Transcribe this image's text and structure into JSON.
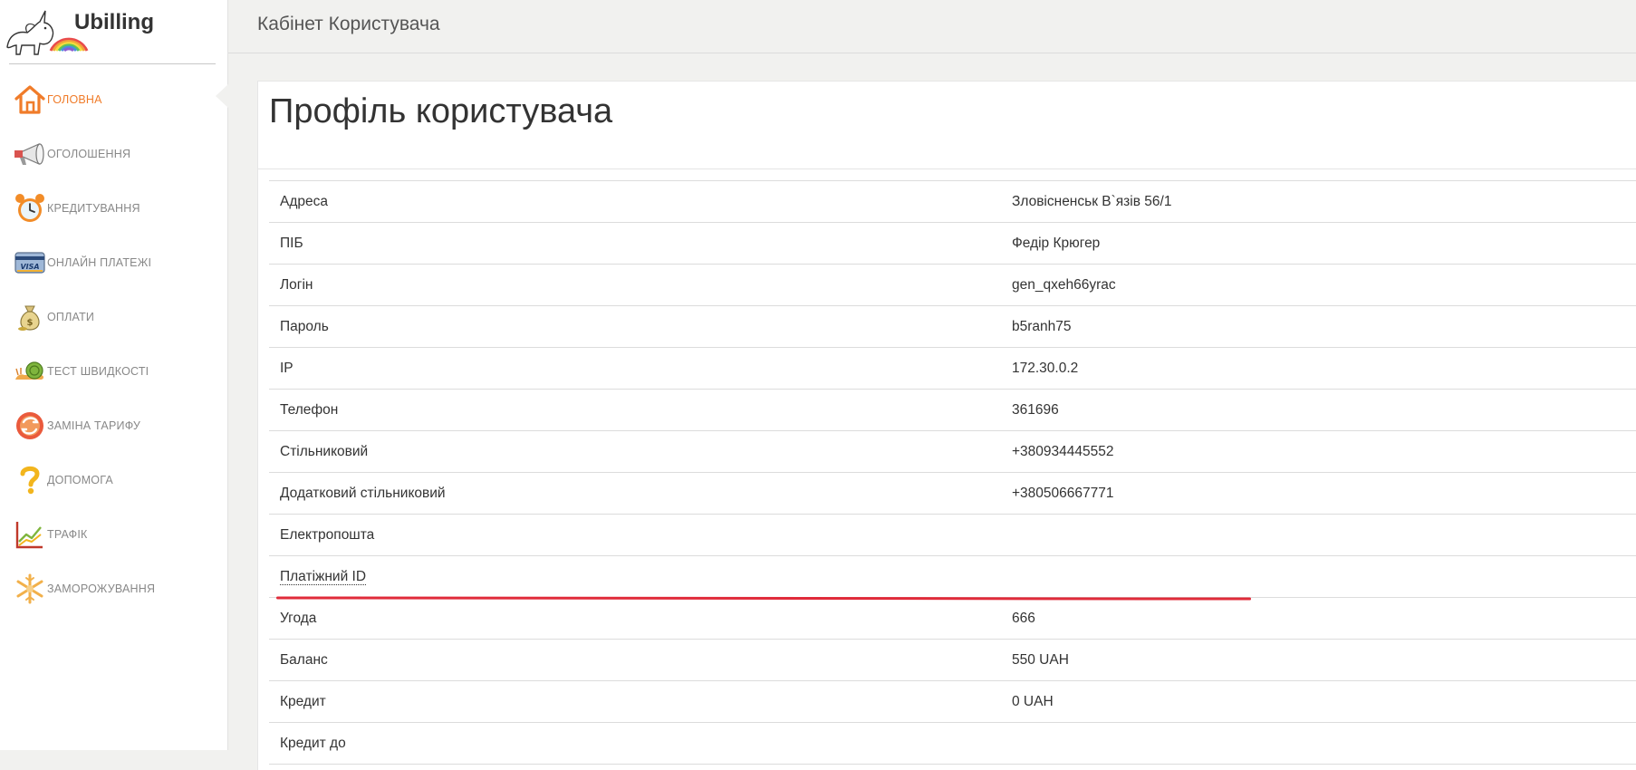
{
  "brand": {
    "name": "Ubilling"
  },
  "menu": [
    {
      "label": "Головна",
      "icon": "home-icon",
      "active": true
    },
    {
      "label": "Оголошення",
      "icon": "megaphone-icon"
    },
    {
      "label": "Кредитування",
      "icon": "alarm-clock-icon"
    },
    {
      "label": "Онлайн платежі",
      "icon": "visa-card-icon"
    },
    {
      "label": "Оплати",
      "icon": "money-bag-icon"
    },
    {
      "label": "Тест швидкості",
      "icon": "snail-icon"
    },
    {
      "label": "Заміна тарифу",
      "icon": "tariff-swap-icon"
    },
    {
      "label": "Допомога",
      "icon": "question-icon"
    },
    {
      "label": "Трафік",
      "icon": "chart-icon"
    },
    {
      "label": "Заморожування",
      "icon": "snowflake-icon"
    }
  ],
  "header": {
    "title": "Кабінет Користувача"
  },
  "profile": {
    "title": "Профіль користувача",
    "rows": [
      {
        "label": "Адреса",
        "value": "Зловісненськ В`язів 56/1"
      },
      {
        "label": "ПІБ",
        "value": "Федір Крюгер"
      },
      {
        "label": "Логін",
        "value": "gen_qxeh66yrac"
      },
      {
        "label": "Пароль",
        "value": "b5ranh75"
      },
      {
        "label": "IP",
        "value": "172.30.0.2"
      },
      {
        "label": "Телефон",
        "value": "361696"
      },
      {
        "label": "Стільниковий",
        "value": "+380934445552"
      },
      {
        "label": "Додатковий стільниковий",
        "value": "+380506667771"
      },
      {
        "label": "Електропошта",
        "value": ""
      },
      {
        "label": "Платіжний ID",
        "value": ""
      },
      {
        "label": "Угода",
        "value": "666"
      },
      {
        "label": "Баланс",
        "value": "550 UAH"
      },
      {
        "label": "Кредит",
        "value": "0 UAH"
      },
      {
        "label": "Кредит до",
        "value": ""
      }
    ]
  },
  "colors": {
    "accent": "#f07c2a",
    "annotation": "#e02b3a"
  }
}
